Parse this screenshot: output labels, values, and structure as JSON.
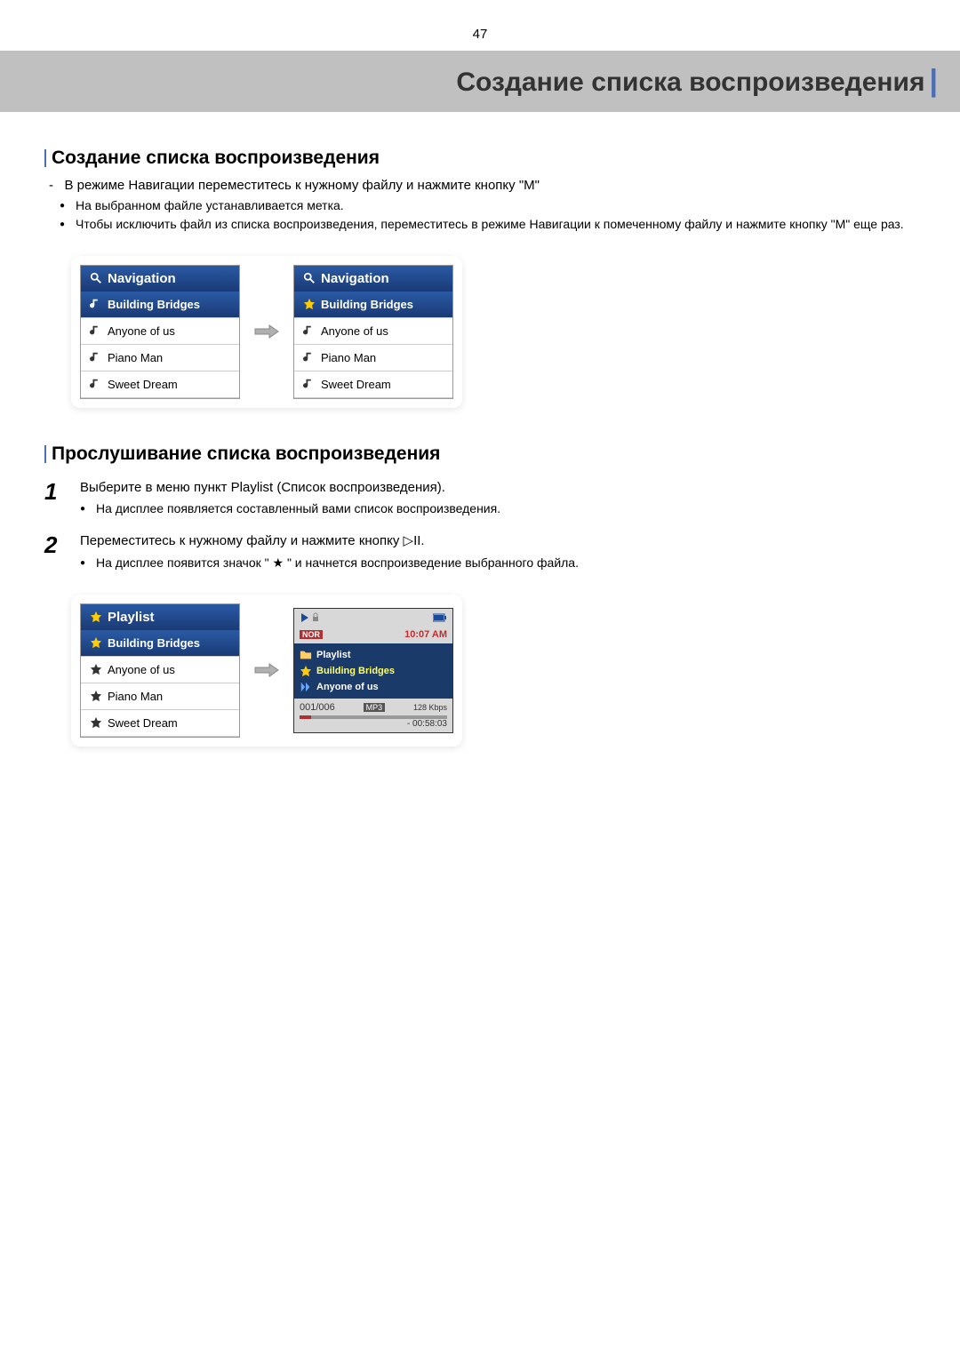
{
  "page_number": "47",
  "title": "Создание списка воспроизведения",
  "section1": {
    "heading": "Создание списка воспроизведения",
    "line1": "В режиме Навигации переместитесь к нужному файлу и нажмите кнопку \"М\"",
    "bullet1": "На выбранном файле устанавливается метка.",
    "bullet2": "Чтобы исключить файл из списка воспроизведения, переместитесь в режиме Навигации к помеченному файлу и нажмите кнопку \"М\" еще раз."
  },
  "nav_screen1": {
    "header": "Navigation",
    "rows": [
      "Building Bridges",
      "Anyone of us",
      "Piano Man",
      "Sweet Dream"
    ]
  },
  "nav_screen2": {
    "header": "Navigation",
    "rows": [
      "Building Bridges",
      "Anyone of us",
      "Piano Man",
      "Sweet Dream"
    ]
  },
  "section2": {
    "heading": "Прослушивание списка воспроизведения"
  },
  "step1": {
    "num": "1",
    "main": "Выберите в меню пункт Playlist (Список воспроизведения).",
    "sub": "На дисплее появляется составленный вами список воспроизведения."
  },
  "step2": {
    "num": "2",
    "main": "Переместитесь к нужному файлу и нажмите кнопку ▷II.",
    "sub": "На дисплее появится значок \" ★ \" и начнется воспроизведение выбранного файла."
  },
  "playlist_screen": {
    "header": "Playlist",
    "rows": [
      "Building Bridges",
      "Anyone of us",
      "Piano Man",
      "Sweet Dream"
    ]
  },
  "player_screen": {
    "nor": "NOR",
    "time": "10:07 AM",
    "label": "Playlist",
    "track1": "Building Bridges",
    "track2": "Anyone of us",
    "counter": "001/006",
    "format": "MP3",
    "kbps": "128 Kbps",
    "elapsed": "- 00:58:03"
  }
}
